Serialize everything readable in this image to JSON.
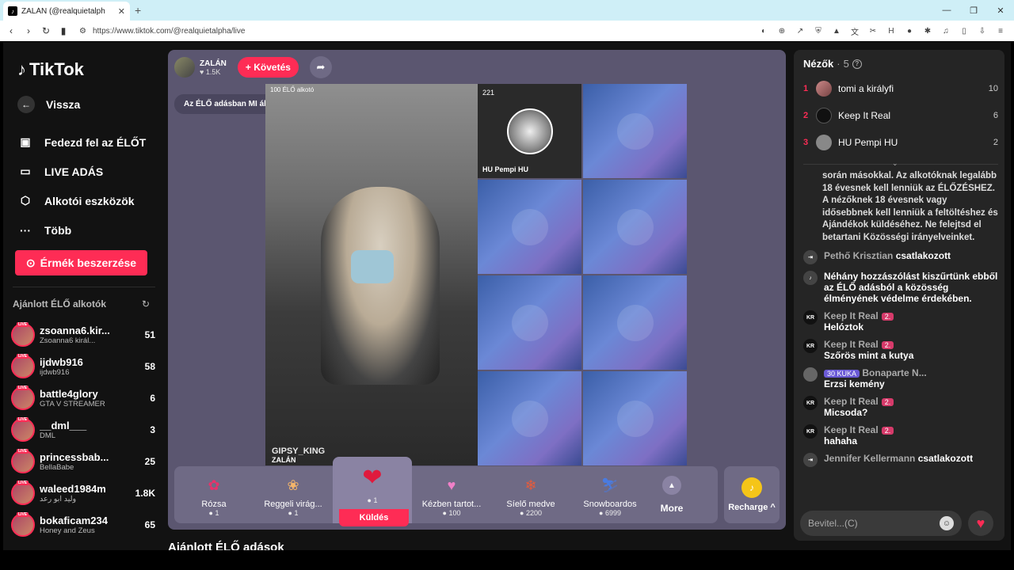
{
  "browser": {
    "tab_title": "ZALÁN (@realquietalph",
    "url": "https://www.tiktok.com/@realquietalpha/live"
  },
  "sidebar": {
    "logo": "TikTok",
    "back": "Vissza",
    "menu": [
      {
        "label": "Fedezd fel az ÉLŐT",
        "icon": "tv-icon"
      },
      {
        "label": "LIVE ADÁS",
        "icon": "camera-icon"
      },
      {
        "label": "Alkotói eszközök",
        "icon": "tools-icon"
      },
      {
        "label": "Több",
        "icon": "more-icon"
      }
    ],
    "coins_button": "Érmék beszerzése",
    "recommended_title": "Ajánlott ÉLŐ alkotók",
    "creators": [
      {
        "name": "zsoanna6.kir...",
        "sub": "Zsoanna6 királ...",
        "count": "51"
      },
      {
        "name": "ijdwb916",
        "sub": "ijdwb916",
        "count": "58"
      },
      {
        "name": "battle4glory",
        "sub": "GTA V STREAMER",
        "count": "6"
      },
      {
        "name": "__dml___",
        "sub": "DML",
        "count": "3"
      },
      {
        "name": "princessbab...",
        "sub": "BellaBabe",
        "count": "25"
      },
      {
        "name": "waleed1984m",
        "sub": "وليد ابو رعد",
        "count": "1.8K"
      },
      {
        "name": "bokaficam234",
        "sub": "Honey and Zeus",
        "count": "65"
      }
    ]
  },
  "stage": {
    "host_name": "ZALÁN",
    "host_likes": "1.5K",
    "follow": "+ Követés",
    "ai_warning": "Az ÉLŐ adásban MI által generált tartalom szerepelhet",
    "video_label": "ÉLŐ alkotó",
    "video_viewers": "100",
    "video_bottom": "GIPSY_KING",
    "video_name": "ZALÁN",
    "grid_main_viewers": "221",
    "grid_main_name": "HU Pempi HU",
    "gifts": [
      {
        "name": "Rózsa",
        "price": "1",
        "icon": "rose-icon"
      },
      {
        "name": "Reggeli virág...",
        "price": "1",
        "icon": "flower-icon"
      },
      {
        "name": "",
        "price": "1",
        "icon": "lips-icon"
      },
      {
        "name": "Kézben tartot...",
        "price": "100",
        "icon": "heart-hands-icon"
      },
      {
        "name": "Síelő medve",
        "price": "2200",
        "icon": "bear-icon"
      },
      {
        "name": "Snowboardos",
        "price": "6999",
        "icon": "snowboard-icon"
      }
    ],
    "send": "Küldés",
    "more": "More",
    "recharge": "Recharge"
  },
  "below": {
    "recommended_live": "Ajánlott ÉLŐ adások"
  },
  "panel": {
    "viewers_label": "Nézők",
    "viewers_count": "5",
    "top": [
      {
        "rank": "1",
        "name": "tomi a királyfi",
        "score": "10"
      },
      {
        "rank": "2",
        "name": "Keep It Real",
        "score": "6"
      },
      {
        "rank": "3",
        "name": "HU Pempi HU",
        "score": "2"
      }
    ],
    "system_text": "során másokkal. Az alkotóknak legalább 18 évesnek kell lenniük az ÉLŐZÉSHEZ. A nézőknek 18 évesnek vagy idősebbnek kell lenniük a feltöltéshez és Ajándékok küldéséhez. Ne felejtsd el betartani Közösségi irányelveinket.",
    "messages": [
      {
        "name": "Pethő Krisztian",
        "text": "csatlakozott",
        "badge": ""
      },
      {
        "name": "",
        "text": "Néhány hozzászólást kiszűrtünk ebből az ÉLŐ adásból a közösség élményének védelme érdekében.",
        "badge": ""
      },
      {
        "name": "Keep It Real",
        "text": "Helóztok",
        "badge": "2."
      },
      {
        "name": "Keep It Real",
        "text": "Szőrös mint a kutya",
        "badge": "2."
      },
      {
        "name": "Bonaparte N...",
        "text": "Erzsi kemény",
        "badge": "30 KUKA"
      },
      {
        "name": "Keep It Real",
        "text": "Micsoda?",
        "badge": "2."
      },
      {
        "name": "Keep It Real",
        "text": "hahaha",
        "badge": "2."
      },
      {
        "name": "Jennifer Kellermann",
        "text": "csatlakozott",
        "badge": ""
      }
    ],
    "input_placeholder": "Bevitel...(C)"
  }
}
